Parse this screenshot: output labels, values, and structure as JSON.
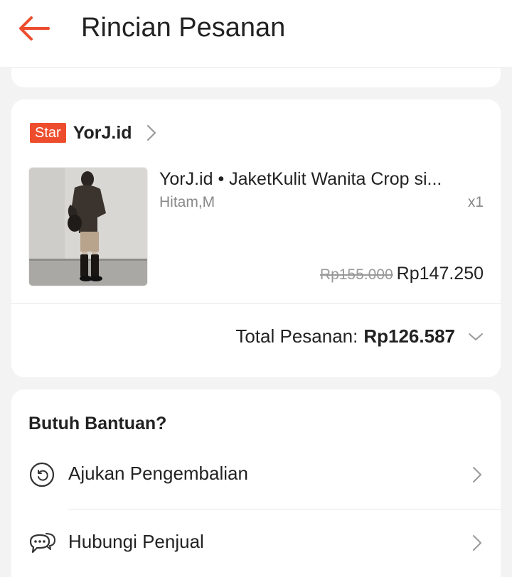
{
  "header": {
    "title": "Rincian Pesanan"
  },
  "shop": {
    "badge": "Star",
    "name": "YorJ.id"
  },
  "product": {
    "name": "YorJ.id • JaketKulit Wanita Crop si...",
    "variant": "Hitam,M",
    "quantity": "x1",
    "price_original": "Rp155.000",
    "price_final": "Rp147.250"
  },
  "order": {
    "total_label": "Total Pesanan:",
    "total_value": "Rp126.587"
  },
  "help": {
    "title": "Butuh Bantuan?",
    "items": [
      {
        "label": "Ajukan Pengembalian",
        "icon": "return-icon"
      },
      {
        "label": "Hubungi Penjual",
        "icon": "chat-icon"
      }
    ]
  },
  "colors": {
    "accent": "#ee4d2d",
    "text": "#222222",
    "muted": "#888888",
    "background": "#f3f3f3"
  }
}
